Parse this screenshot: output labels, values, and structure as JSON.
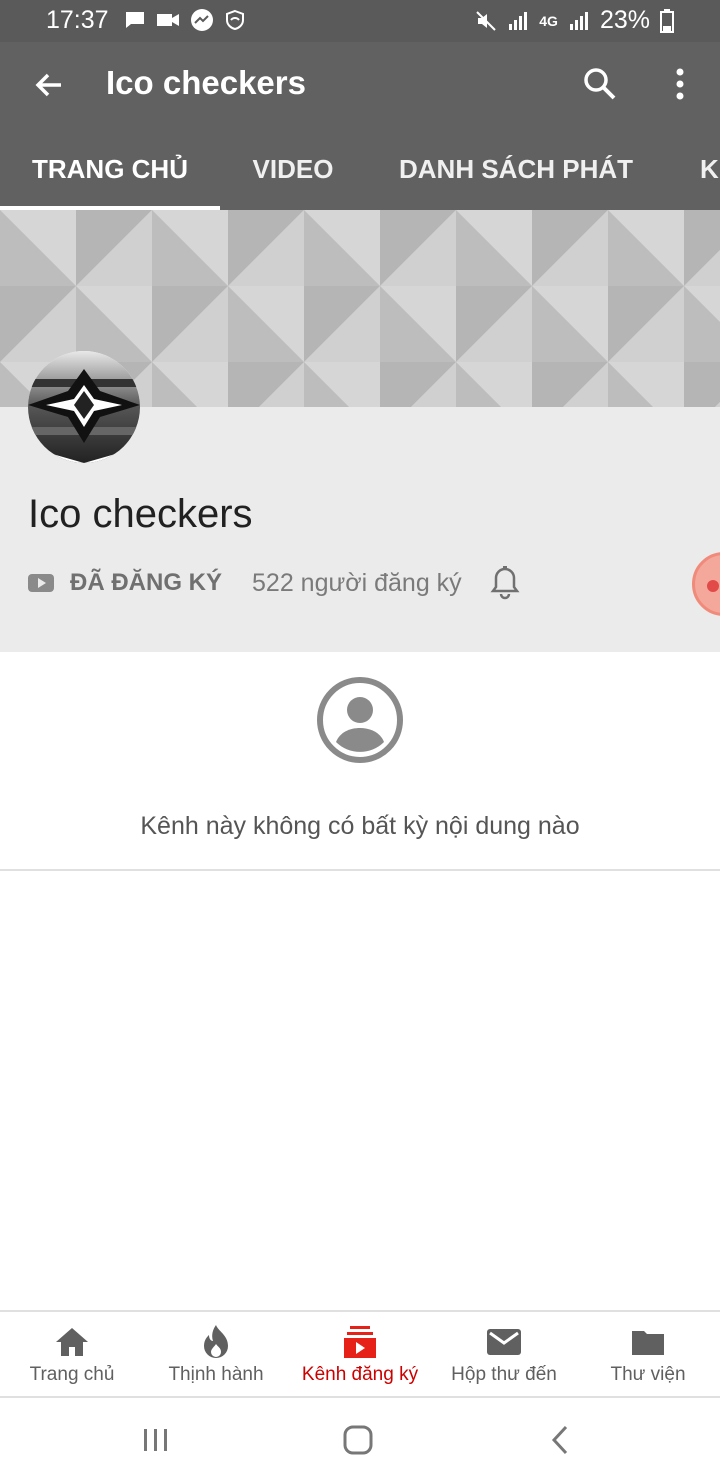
{
  "status_bar": {
    "time": "17:37",
    "battery": "23%",
    "network_label": "4G"
  },
  "app_bar": {
    "title": "Ico checkers",
    "icons": [
      "back-arrow-icon",
      "search-icon",
      "more-vert-icon"
    ]
  },
  "tabs": [
    {
      "label": "TRANG CHỦ",
      "active": true
    },
    {
      "label": "VIDEO",
      "active": false
    },
    {
      "label": "DANH SÁCH PHÁT",
      "active": false
    },
    {
      "label": "K",
      "active": false
    }
  ],
  "channel": {
    "name": "Ico checkers",
    "subscribed_label": "ĐÃ ĐĂNG KÝ",
    "subscriber_count": "522 người đăng ký"
  },
  "empty_state": {
    "message": "Kênh này không có bất kỳ nội dung nào"
  },
  "bottom_nav": {
    "items": [
      {
        "label": "Trang chủ",
        "icon": "home-icon",
        "active": false
      },
      {
        "label": "Thịnh hành",
        "icon": "flame-icon",
        "active": false
      },
      {
        "label": "Kênh đăng ký",
        "icon": "subscriptions-icon",
        "active": true
      },
      {
        "label": "Hộp thư đến",
        "icon": "mail-icon",
        "active": false
      },
      {
        "label": "Thư viện",
        "icon": "folder-icon",
        "active": false
      }
    ]
  },
  "colors": {
    "app_bar": "#616161",
    "status_bar": "#5a5a5a",
    "active_red": "#cc0000",
    "header_bg": "#ebebeb"
  }
}
